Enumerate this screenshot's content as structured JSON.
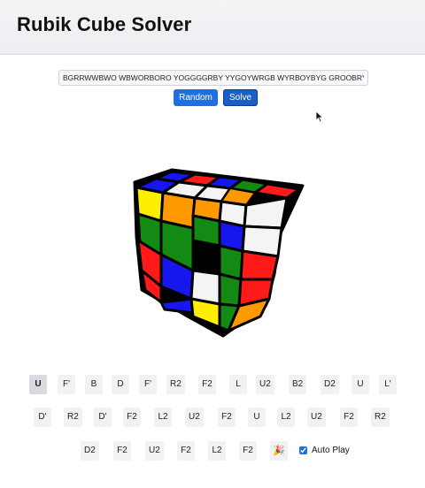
{
  "app": {
    "title": "Rubik Cube Solver"
  },
  "input": {
    "value": "BGRRWWBWO WBWORBORO YOGGGGRBY YYGOYWRGB WYRBOYBYG GROOBRYWW"
  },
  "buttons": {
    "random": "Random",
    "solve": "Solve"
  },
  "moves": {
    "row1": [
      "U",
      "F'",
      "B",
      "D",
      "F'",
      "R2",
      "F2",
      "L",
      "U2",
      "B2",
      "D2",
      "U",
      "L'"
    ],
    "row2": [
      "D'",
      "R2",
      "D'",
      "F2",
      "L2",
      "U2",
      "F2",
      "U",
      "L2",
      "U2",
      "F2",
      "R2"
    ],
    "row3": [
      "D2",
      "F2",
      "U2",
      "F2",
      "L2",
      "F2"
    ],
    "active_index": 0
  },
  "party_icon": "party-popper-icon",
  "autoplay": {
    "label": "Auto Play",
    "checked": true
  },
  "colors": {
    "accent": "#1f6fe0",
    "cube_white": "#f4f4f4",
    "cube_yellow": "#ffee00",
    "cube_red": "#ff1a1a",
    "cube_orange": "#ff9900",
    "cube_green": "#138a13",
    "cube_blue": "#1616ee"
  }
}
